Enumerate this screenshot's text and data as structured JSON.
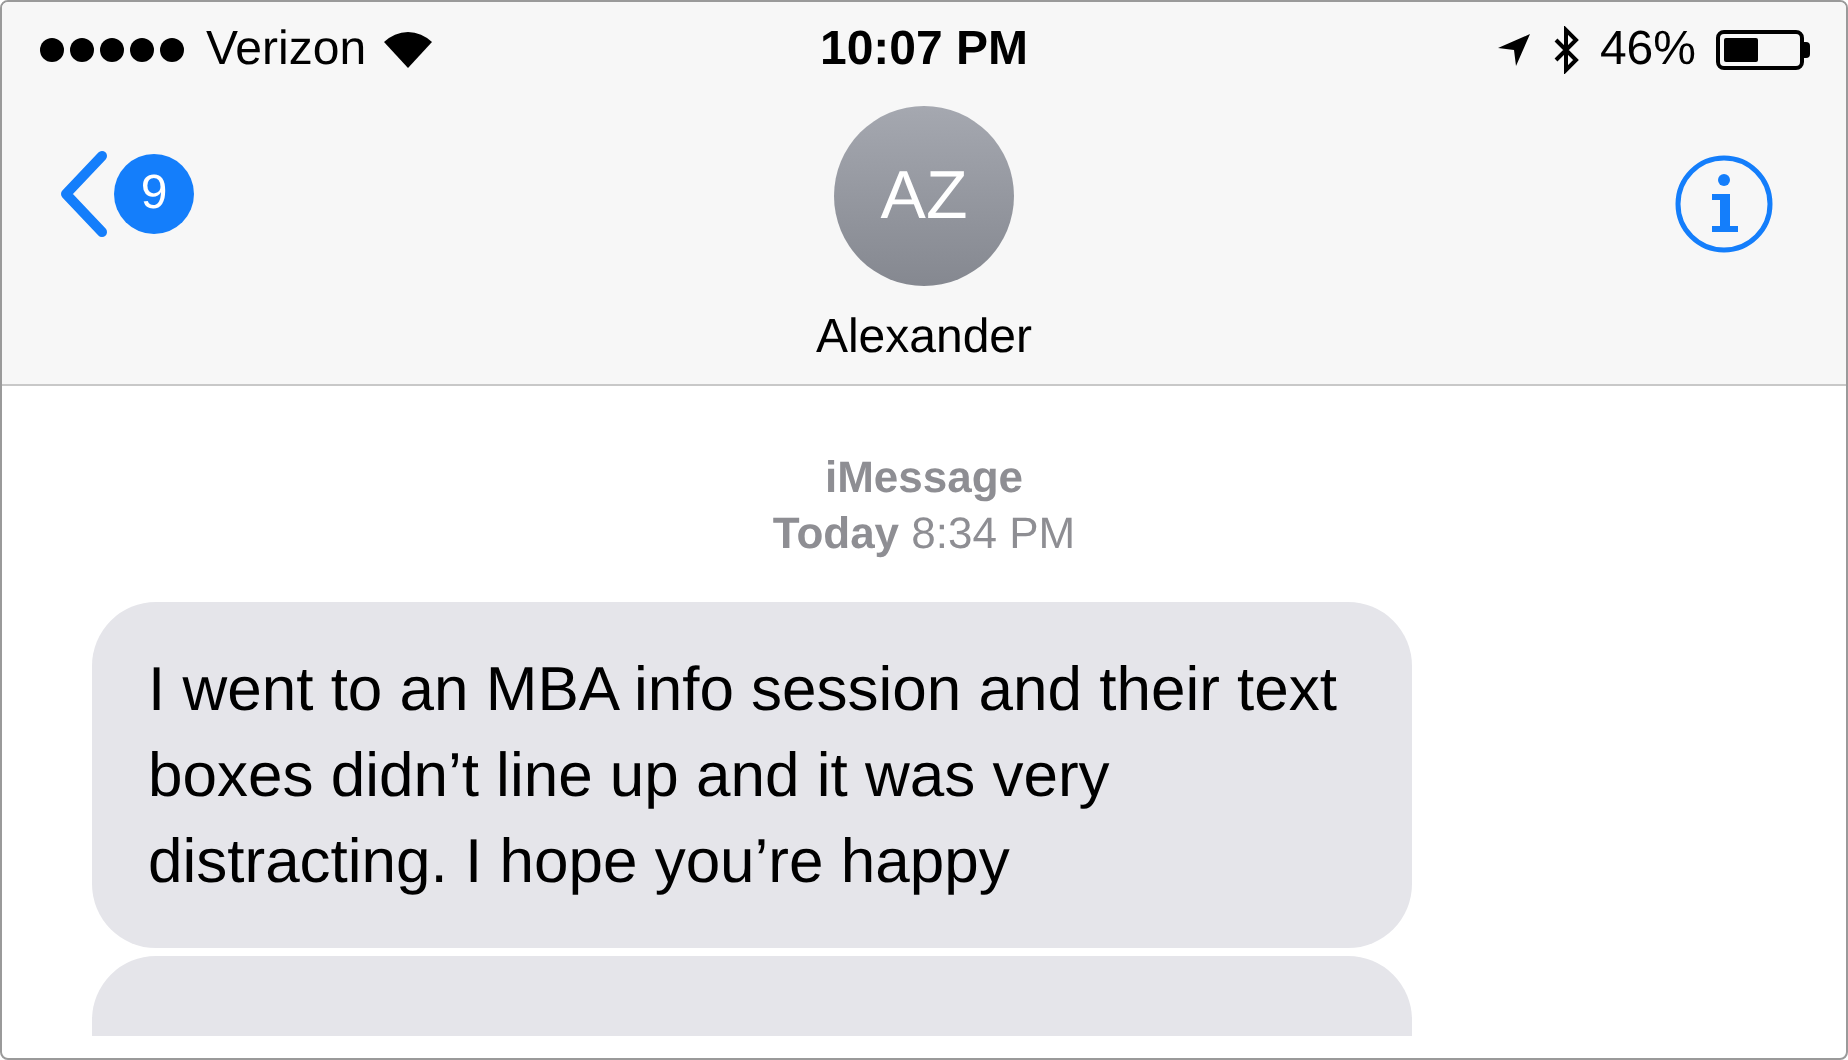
{
  "status_bar": {
    "carrier": "Verizon",
    "time": "10:07 PM",
    "battery_text": "46%",
    "battery": {
      "level": 0.46
    }
  },
  "nav": {
    "back_badge": "9",
    "avatar_initials": "AZ",
    "contact_name": "Alexander"
  },
  "conversation": {
    "service": "iMessage",
    "timestamp": "**Today** 8:34 PM",
    "messages": [
      {
        "text": "I went to an MBA info session and their text boxes didn’t line up and it was very distracting. I hope you’re happy",
        "incoming": true
      }
    ]
  }
}
